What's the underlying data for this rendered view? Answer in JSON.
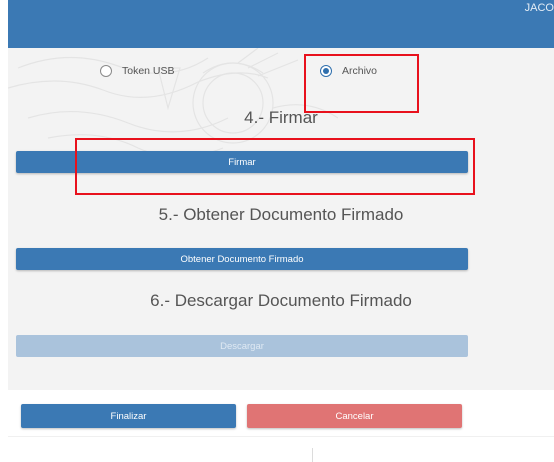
{
  "header": {
    "user_text": "JACO"
  },
  "signing_method": {
    "options": [
      {
        "label": "Token USB",
        "selected": false
      },
      {
        "label": "Archivo",
        "selected": true
      }
    ]
  },
  "steps": {
    "sign": {
      "title": "4.- Firmar",
      "button": "Firmar"
    },
    "obtain": {
      "title": "5.- Obtener Documento Firmado",
      "button": "Obtener Documento Firmado"
    },
    "download": {
      "title": "6.- Descargar Documento Firmado",
      "button": "Descargar",
      "enabled": false
    }
  },
  "footer": {
    "finish": "Finalizar",
    "cancel": "Cancelar"
  },
  "colors": {
    "primary": "#3b79b4",
    "disabled": "#aac3dc",
    "danger": "#e07474",
    "highlight": "#e8111c",
    "panel": "#f3f3f3"
  }
}
